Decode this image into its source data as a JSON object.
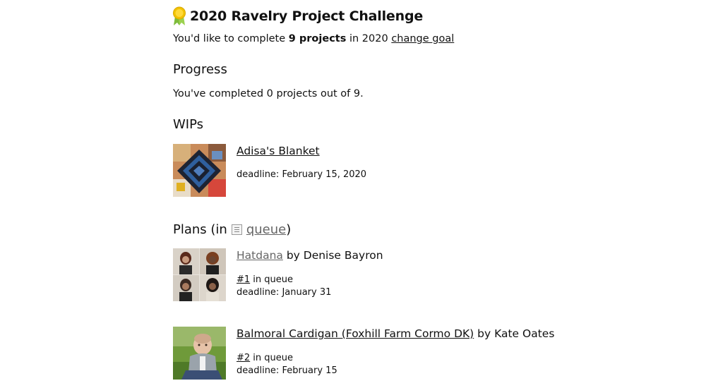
{
  "challenge": {
    "title": "2020 Ravelry Project Challenge",
    "goal_prefix": "You'd like to complete ",
    "goal_count": "9 projects",
    "goal_suffix": " in 2020 ",
    "change_goal": "change goal"
  },
  "progress": {
    "heading": "Progress",
    "text": "You've completed 0 projects out of 9."
  },
  "wips": {
    "heading": "WIPs",
    "items": [
      {
        "title": "Adisa's Blanket",
        "deadline": "deadline: February 15, 2020"
      }
    ]
  },
  "plans": {
    "heading_open": "Plans (in",
    "queue_link": "queue",
    "heading_close": ")",
    "items": [
      {
        "title": "Hatdana",
        "by": " by Denise Bayron",
        "queue_num": "#1",
        "queue_text": " in queue",
        "deadline": "deadline: January 31"
      },
      {
        "title": "Balmoral Cardigan (Foxhill Farm Cormo DK)",
        "by": " by Kate Oates",
        "queue_num": "#2",
        "queue_text": " in queue",
        "deadline": "deadline: February 15"
      }
    ]
  },
  "icons": {
    "medal": "medal-icon",
    "queue": "queue-list-icon"
  },
  "colors": {
    "link": "#111111",
    "muted_link": "#666666",
    "medal_gold": "#f2c200",
    "medal_ribbon": "#8cc63f"
  }
}
